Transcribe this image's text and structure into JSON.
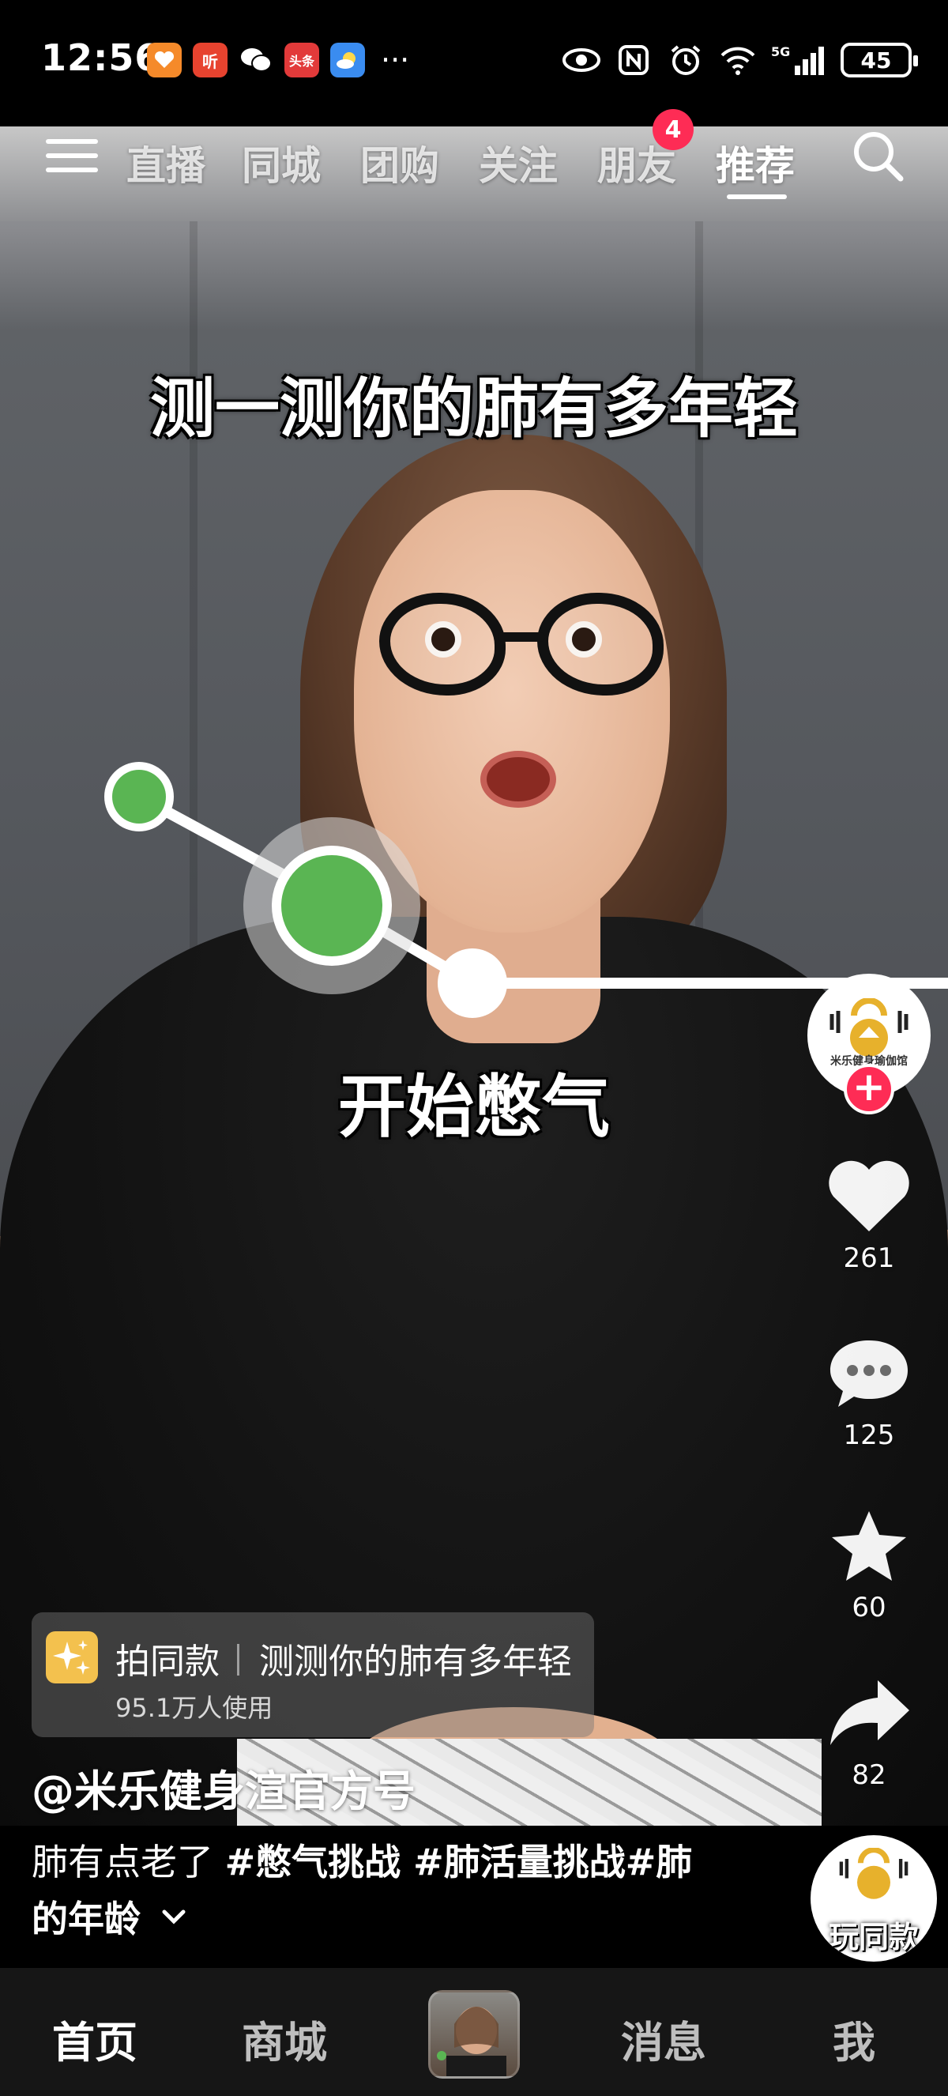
{
  "status_bar": {
    "time": "12:56",
    "apps": [
      {
        "name": "taobao-heart",
        "label": "",
        "color": "#f58a2a"
      },
      {
        "name": "ting",
        "label": "听",
        "color": "#e7432f"
      },
      {
        "name": "wechat",
        "label": "",
        "color": "#2dbd5b"
      },
      {
        "name": "toutiao",
        "label": "头条",
        "color": "#e23a3a"
      },
      {
        "name": "weather",
        "label": "",
        "color": "#3a8cf0"
      }
    ],
    "more": "···",
    "signal_label": "5G",
    "battery": "45"
  },
  "top_nav": {
    "tabs": [
      {
        "label": "直播",
        "active": false
      },
      {
        "label": "同城",
        "active": false
      },
      {
        "label": "团购",
        "active": false
      },
      {
        "label": "关注",
        "active": false
      },
      {
        "label": "朋友",
        "active": false
      },
      {
        "label": "推荐",
        "active": true
      }
    ],
    "friends_badge": "4"
  },
  "video": {
    "headline": "测一测你的肺有多年轻",
    "caption": "开始憋气"
  },
  "right_rail": {
    "avatar_name": "米乐健身瑜伽馆",
    "likes": "261",
    "comments": "125",
    "favorites": "60",
    "shares": "82"
  },
  "effect": {
    "label": "拍同款",
    "name": "测测你的肺有多年轻",
    "users": "95.1万人使用"
  },
  "author": "@米乐健身渲官方号",
  "description": {
    "text": "肺有点老了 ",
    "tags": "#憋气挑战 #肺活量挑战#肺",
    "line2": "的年龄"
  },
  "play_same": {
    "label": "玩同款"
  },
  "bottom_nav": {
    "items": [
      {
        "label": "首页",
        "active": true
      },
      {
        "label": "商城",
        "active": false
      },
      {
        "label": "消息",
        "active": false
      },
      {
        "label": "我",
        "active": false
      }
    ]
  },
  "colors": {
    "accent_red": "#fe2c55",
    "breath_green": "#5ab553",
    "effect_icon": "#f3c14e"
  }
}
